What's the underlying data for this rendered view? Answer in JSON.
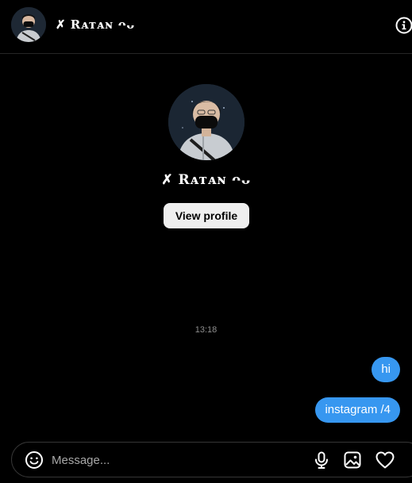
{
  "header": {
    "name": "✗ Rᴀᴛᴀɴ ᴖᴗ",
    "avatar_icon": "avatar-photo",
    "info_icon": "info-icon"
  },
  "profile": {
    "name": "✗ Rᴀᴛᴀɴ ᴖᴗ",
    "view_profile_label": "View profile",
    "avatar_icon": "avatar-photo"
  },
  "thread": {
    "timestamp": "13:18",
    "messages": [
      {
        "text": "hi",
        "from": "me"
      },
      {
        "text": "instagram /4",
        "from": "me"
      }
    ]
  },
  "composer": {
    "placeholder": "Message...",
    "value": "",
    "icons": [
      "emoji-icon",
      "microphone-icon",
      "image-icon",
      "heart-icon"
    ]
  },
  "colors": {
    "background": "#000000",
    "bubble": "#3797f0",
    "button": "#efefef",
    "muted": "#8e8e8e",
    "border": "#363636"
  }
}
